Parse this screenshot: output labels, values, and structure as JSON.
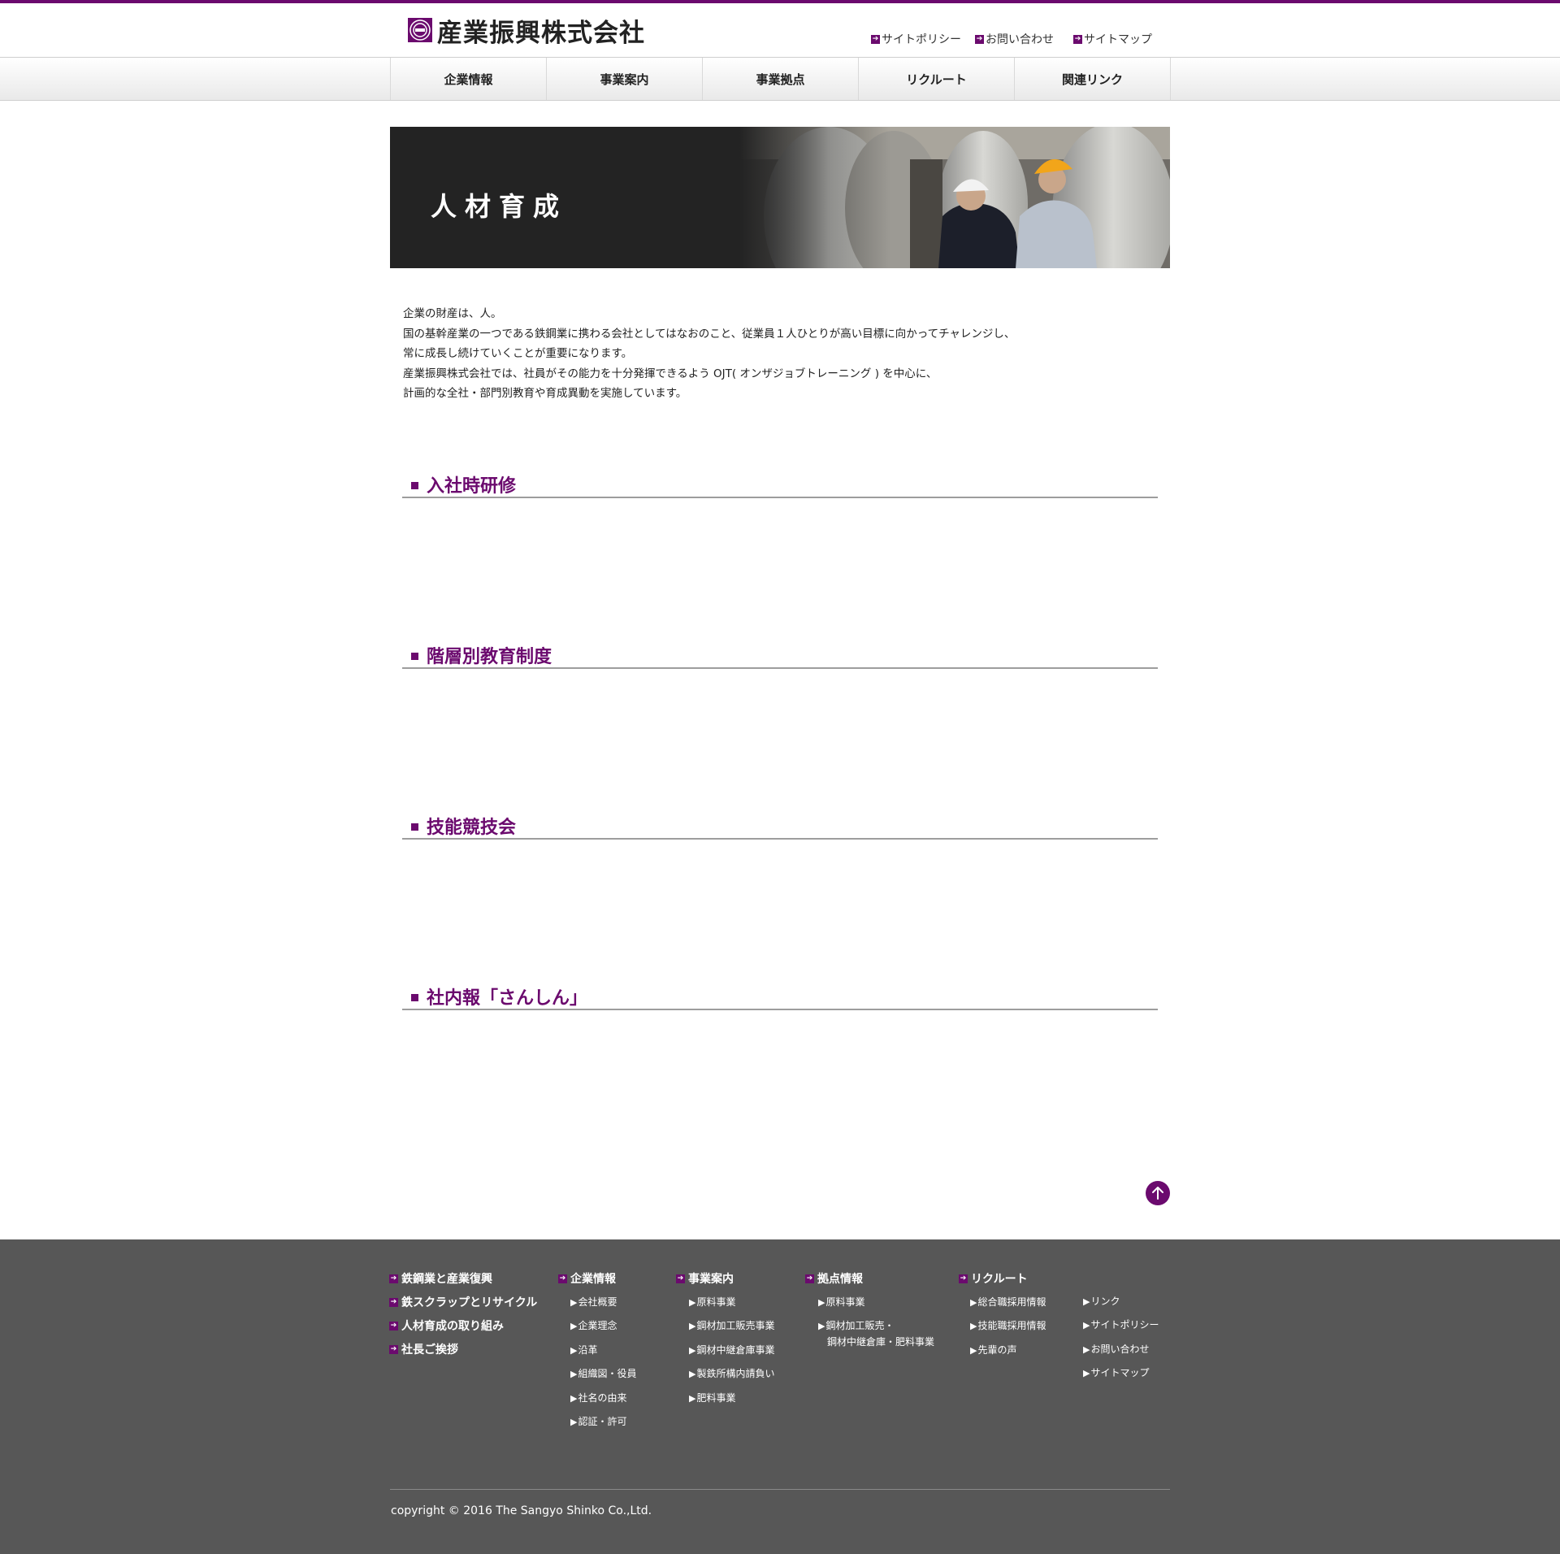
{
  "colors": {
    "accent": "#6b0a6e",
    "footer_bg": "#575757",
    "banner_bg": "#232323"
  },
  "header": {
    "logo_icon": "company-crest-icon",
    "company_name": "産業振興株式会社",
    "util_links": [
      "サイトポリシー",
      "お問い合わせ",
      "サイトマップ"
    ]
  },
  "nav": {
    "items": [
      "企業情報",
      "事業案内",
      "事業拠点",
      "リクルート",
      "関連リンク"
    ]
  },
  "banner": {
    "title": "人材育成"
  },
  "intro": {
    "lines": [
      "企業の財産は、人。",
      "国の基幹産業の一つである鉄鋼業に携わる会社としてはなおのこと、従業員１人ひとりが高い目標に向かってチャレンジし、",
      "常に成長し続けていくことが重要になります。",
      "産業振興株式会社では、社員がその能力を十分発揮できるよう OJT( オンザジョブトレーニング ) を中心に、",
      "計画的な全社・部門別教育や育成異動を実施しています。"
    ]
  },
  "sections": [
    "入社時研修",
    "階層別教育制度",
    "技能競技会",
    "社内報「さんしん」"
  ],
  "to_top_icon": "arrow-up-icon",
  "footer": {
    "col1": [
      "鉄鋼業と産業復興",
      "鉄スクラップとリサイクル",
      "人材育成の取り組み",
      "社長ご挨拶"
    ],
    "col2": {
      "head": "企業情報",
      "links": [
        "会社概要",
        "企業理念",
        "沿革",
        "組織図・役員",
        "社名の由来",
        "認証・許可"
      ]
    },
    "col3": {
      "head": "事業案内",
      "links": [
        "原料事業",
        "鋼材加工販売事業",
        "鋼材中継倉庫事業",
        "製鉄所構内請負い",
        "肥料事業"
      ]
    },
    "col4": {
      "head": "拠点情報",
      "links": [
        "原料事業",
        "鋼材加工販売・",
        "鋼材中継倉庫・肥料事業"
      ]
    },
    "col5": {
      "head": "リクルート",
      "links": [
        "総合職採用情報",
        "技能職採用情報",
        "先輩の声"
      ]
    },
    "col6": {
      "links": [
        "リンク",
        "サイトポリシー",
        "お問い合わせ",
        "サイトマップ"
      ]
    },
    "copyright": "copyright © 2016 The Sangyo Shinko Co.,Ltd."
  }
}
